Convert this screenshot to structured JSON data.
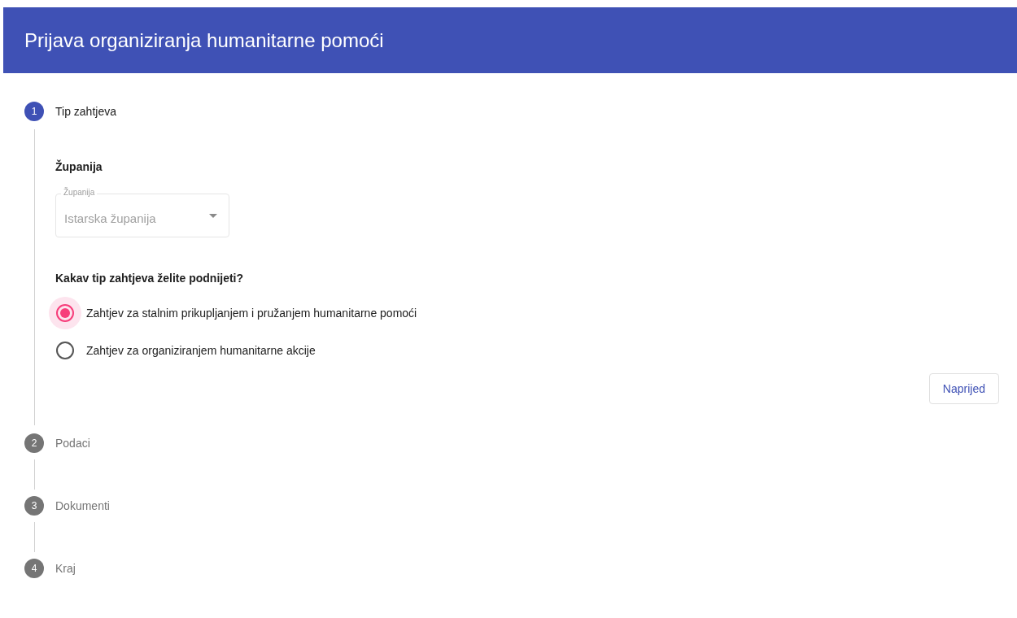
{
  "header": {
    "title": "Prijava organiziranja humanitarne pomoći"
  },
  "steps": [
    {
      "number": "1",
      "label": "Tip zahtjeva",
      "active": true
    },
    {
      "number": "2",
      "label": "Podaci",
      "active": false
    },
    {
      "number": "3",
      "label": "Dokumenti",
      "active": false
    },
    {
      "number": "4",
      "label": "Kraj",
      "active": false
    }
  ],
  "form": {
    "county_heading": "Županija",
    "county_select": {
      "label": "Županija",
      "value": "Istarska županija",
      "disabled": true
    },
    "question": "Kakav tip zahtjeva želite podnijeti?",
    "options": [
      {
        "label": "Zahtjev za stalnim prikupljanjem i pružanjem humanitarne pomoći",
        "selected": true
      },
      {
        "label": "Zahtjev za organiziranjem humanitarne akcije",
        "selected": false
      }
    ],
    "next_button": "Naprijed"
  }
}
